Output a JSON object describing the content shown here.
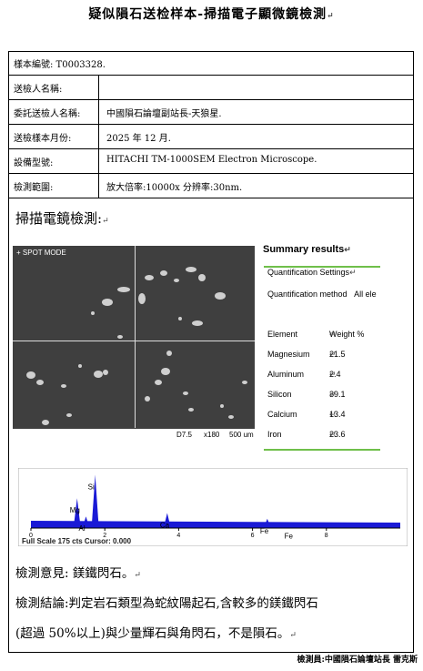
{
  "title": "疑似隕石送检样本-掃描電子顯微鏡檢測",
  "para_mark": "↵",
  "info_rows": [
    {
      "key": "樣本編號: T0003328.",
      "value": ""
    },
    {
      "key": "送檢人名稱:",
      "value": ""
    },
    {
      "key": "委託送檢人名稱:",
      "value": "中國隕石論壇副站長-天狼星."
    },
    {
      "key": "送檢樣本月份:",
      "value": "2025 年 12 月."
    },
    {
      "key": "設備型號:",
      "value": "HITACHI TM-1000SEM Electron Microscope."
    },
    {
      "key": "檢測範圍:",
      "value": "放大倍率:10000x 分辨率:30nm."
    }
  ],
  "section_title": "掃描電鏡檢測:",
  "sem_image": {
    "mode_label": "+ SPOT MODE",
    "working_distance": "D7.5",
    "magnification": "x180",
    "scale": "500 um"
  },
  "summary": {
    "title": "Summary results",
    "settings_label": "Quantification Settings",
    "method_label": "Quantification method",
    "method_value": "All ele",
    "header_element": "Element",
    "header_weight": "Weight %",
    "rows": [
      {
        "element": "Magnesium",
        "weight": "21.5"
      },
      {
        "element": "Aluminum",
        "weight": "2.4"
      },
      {
        "element": "Silicon",
        "weight": "39.1"
      },
      {
        "element": "Calcium",
        "weight": "13.4"
      },
      {
        "element": "Iron",
        "weight": "23.6"
      }
    ]
  },
  "chart_data": {
    "type": "line",
    "title": "",
    "footer": "Full Scale 175 cts Cursor: 0.000",
    "x_ticks": [
      "0",
      "2",
      "4",
      "6",
      "8"
    ],
    "xlim": [
      0,
      10
    ],
    "peak_labels": [
      "Mg",
      "Al",
      "Si",
      "Ca",
      "Fe",
      "Fe"
    ],
    "peaks": [
      {
        "label": "Mg",
        "x": 1.25,
        "y": 90
      },
      {
        "label": "Al",
        "x": 1.49,
        "y": 35
      },
      {
        "label": "Si",
        "x": 1.74,
        "y": 160
      },
      {
        "label": "Ca",
        "x": 3.69,
        "y": 45
      },
      {
        "label": "Fe",
        "x": 6.4,
        "y": 28
      },
      {
        "label": "Fe",
        "x": 7.06,
        "y": 12
      }
    ],
    "colors": {
      "fill": "#1a1ad6",
      "axis": "#000000"
    }
  },
  "opinion": "檢測意見: 鎂鐵閃石。",
  "conclusion_line1": "檢測結論:判定岩石類型為蛇紋陽起石,含較多的鎂鐵閃石",
  "conclusion_line2": "(超過 50%以上)與少量輝石與角閃石，不是隕石。",
  "signature": "檢測員:中國隕石論壇站長 雷克斯"
}
